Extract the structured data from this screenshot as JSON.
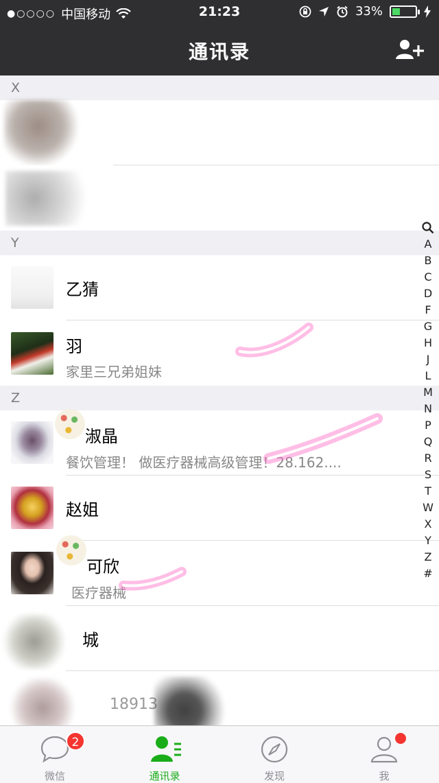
{
  "status_bar": {
    "signal_dots": "●○○○○",
    "carrier": "中国移动",
    "time": "21:23",
    "battery": "33%",
    "battery_level": 0.33,
    "icons": [
      "wifi-icon",
      "lock-rotation-icon",
      "location-arrow-icon",
      "alarm-icon",
      "charging-bolt-icon"
    ]
  },
  "header": {
    "title": "通讯录",
    "add_button_icon": "add-contact-icon"
  },
  "sections": [
    {
      "letter": "X",
      "contacts": [
        {
          "name": "",
          "subtitle": ""
        },
        {
          "name": "",
          "subtitle": ""
        }
      ]
    },
    {
      "letter": "Y",
      "contacts": [
        {
          "name": "乙猜",
          "subtitle": ""
        },
        {
          "name": "羽",
          "subtitle": "家里三兄弟姐妹"
        }
      ]
    },
    {
      "letter": "Z",
      "contacts": [
        {
          "name": "淑晶",
          "subtitle": "餐饮管理！ 做医疗器械高级管理！28.162...."
        },
        {
          "name": "赵姐",
          "subtitle": ""
        },
        {
          "name": "可欣",
          "subtitle": "医疗器械"
        },
        {
          "name": "城",
          "subtitle": ""
        },
        {
          "name": "",
          "subtitle": "18913"
        }
      ]
    }
  ],
  "index_bar": [
    "A",
    "B",
    "C",
    "D",
    "F",
    "G",
    "H",
    "J",
    "L",
    "M",
    "N",
    "P",
    "Q",
    "R",
    "S",
    "T",
    "W",
    "X",
    "Y",
    "Z",
    "#"
  ],
  "index_search_icon": "search-icon",
  "tabs": [
    {
      "label": "微信",
      "icon": "chat-bubble-icon",
      "badge": "2",
      "active": false
    },
    {
      "label": "通讯录",
      "icon": "contacts-icon",
      "active": true
    },
    {
      "label": "发现",
      "icon": "compass-icon",
      "active": false
    },
    {
      "label": "我",
      "icon": "person-icon",
      "dot": true,
      "active": false
    }
  ],
  "colors": {
    "header_bg": "#2f2f31",
    "accent_green": "#1aad19",
    "badge_red": "#f43530"
  }
}
